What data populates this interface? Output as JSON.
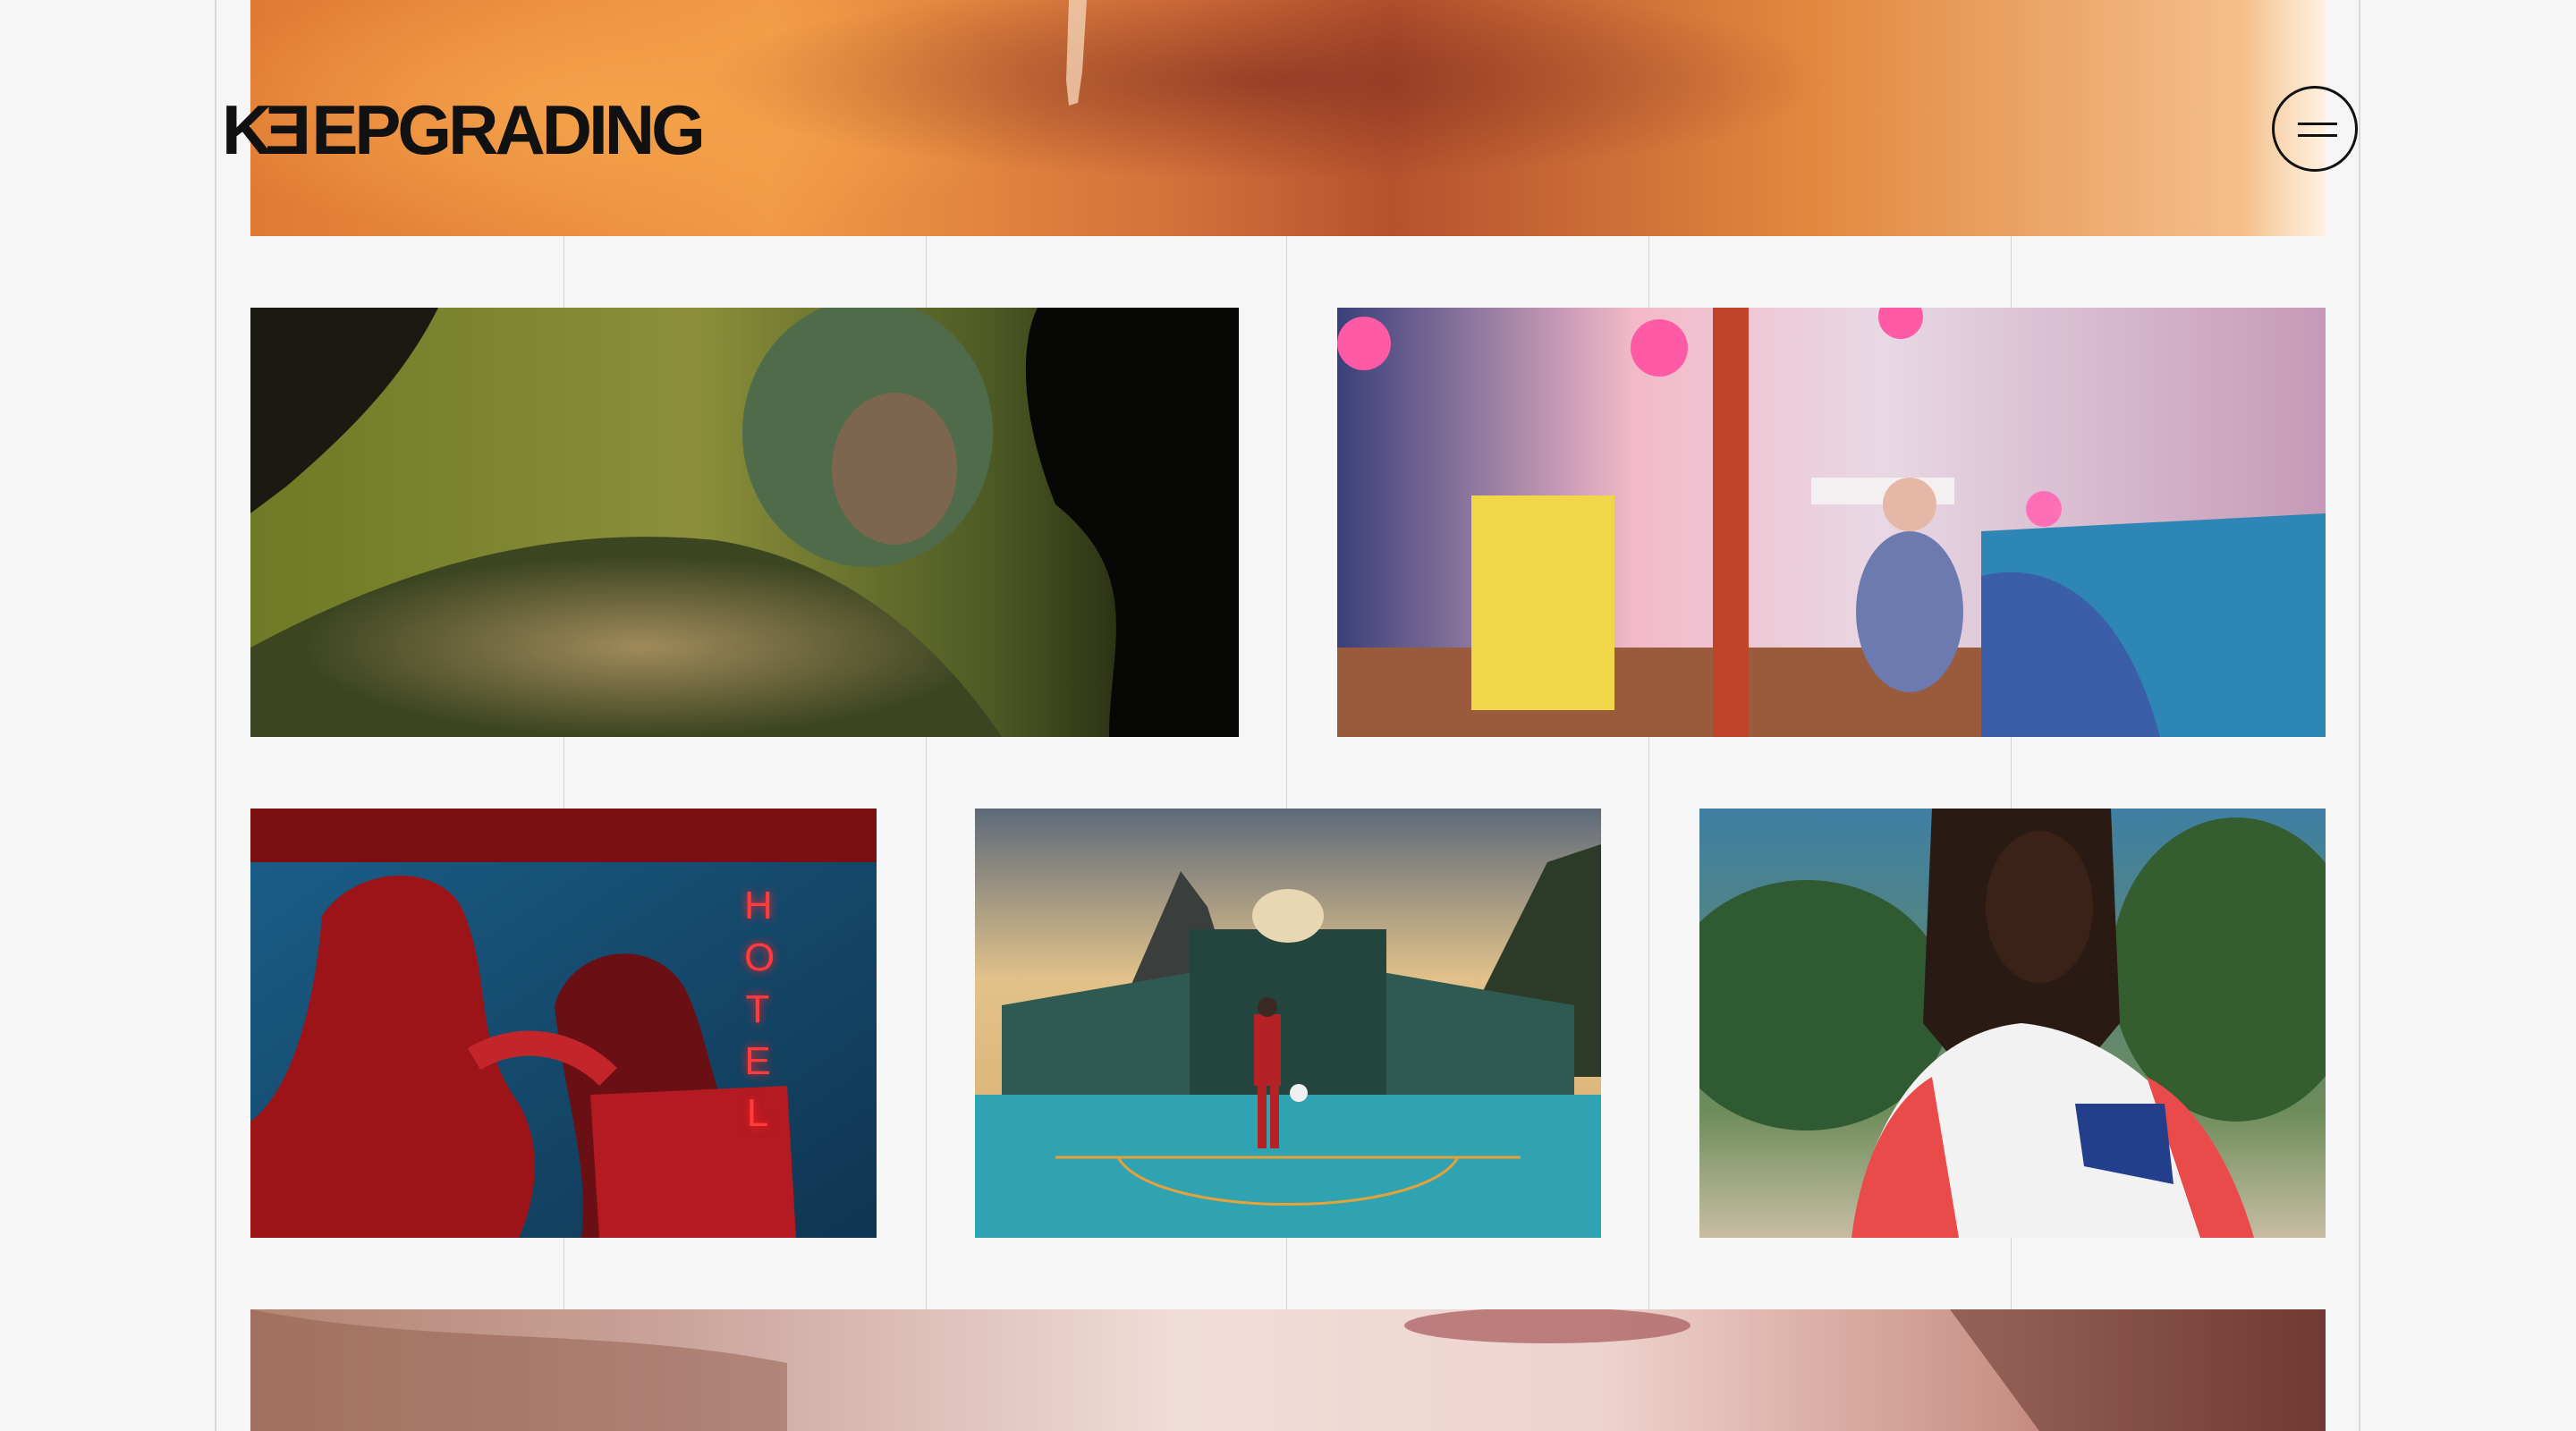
{
  "header": {
    "logo_text": "KEEPGRADING",
    "logo_text_part1": "K",
    "logo_text_flipped": "E",
    "logo_text_part2": "EPGRADING",
    "menu_icon": "hamburger-menu-icon"
  },
  "gallery": {
    "items": [
      {
        "id": "hero",
        "description": "warm orange desert frame, cropped at top"
      },
      {
        "id": "tattoo",
        "description": "tattooed man in green light"
      },
      {
        "id": "bedroom",
        "description": "girl sitting in pink bedroom with heart balloons"
      },
      {
        "id": "hotel",
        "description": "couple in red light with HOTEL neon sign",
        "neon_text": "HOTEL"
      },
      {
        "id": "court",
        "description": "footballer on teal court with mountains"
      },
      {
        "id": "portrait",
        "description": "woman with braids in white and red jacket"
      },
      {
        "id": "face",
        "description": "close-up face, cropped at bottom"
      }
    ]
  },
  "colors": {
    "background": "#f6f6f6",
    "ink": "#111111",
    "grid_line": "#d6d6d6"
  }
}
